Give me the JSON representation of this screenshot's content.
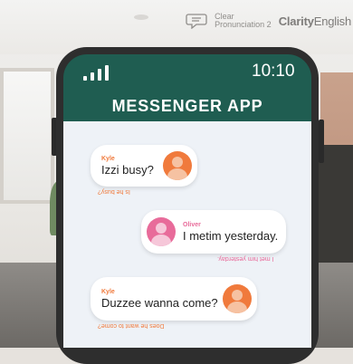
{
  "brand": {
    "product_line1": "Clear",
    "product_line2": "Pronunciation 2",
    "company_bold": "Clarity",
    "company_light": "English"
  },
  "phone": {
    "time": "10:10",
    "app_title": "MESSENGER APP"
  },
  "messages": [
    {
      "sender": "Kyle",
      "text": "Izzi busy?",
      "hint": "Is he busy?",
      "align": "left"
    },
    {
      "sender": "Oliver",
      "text": "I metim yesterday.",
      "hint": "I met him yesterday.",
      "align": "right"
    },
    {
      "sender": "Kyle",
      "text": "Duzzee wanna come?",
      "hint": "Does he want to come?",
      "align": "left"
    }
  ],
  "colors": {
    "header_green": "#1f5d51",
    "kyle_orange": "#f07a3c",
    "oliver_pink": "#e86b9a"
  },
  "icons": {
    "brand": "speech-bubble-icon",
    "signal": "signal-bars-icon",
    "avatar": "person-avatar-icon"
  }
}
